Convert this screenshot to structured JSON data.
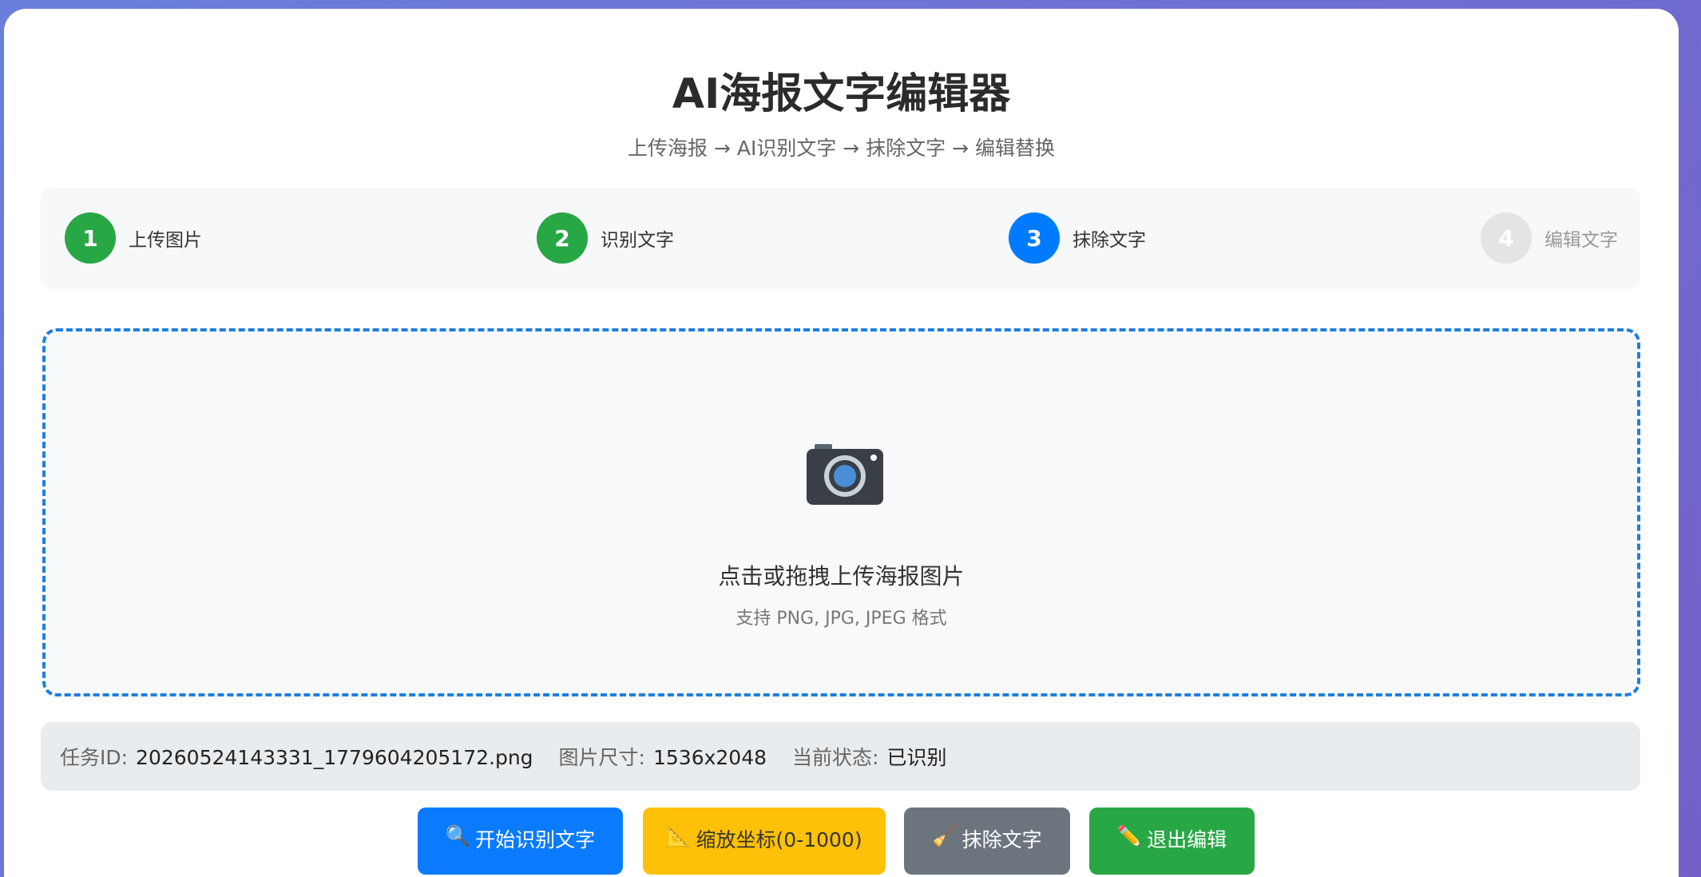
{
  "header": {
    "title": "AI海报文字编辑器",
    "subtitle": "上传海报 → AI识别文字 → 抹除文字 → 编辑替换"
  },
  "steps": [
    {
      "number": "1",
      "label": "上传图片",
      "state": "done"
    },
    {
      "number": "2",
      "label": "识别文字",
      "state": "done"
    },
    {
      "number": "3",
      "label": "抹除文字",
      "state": "active"
    },
    {
      "number": "4",
      "label": "编辑文字",
      "state": "pending"
    }
  ],
  "upload": {
    "icon": "camera-icon",
    "title": "点击或拖拽上传海报图片",
    "hint": "支持 PNG, JPG, JPEG 格式"
  },
  "info": {
    "task_id_label": "任务ID:",
    "task_id_value": "20260524143331_1779604205172.png",
    "size_label": "图片尺寸:",
    "size_value": "1536x2048",
    "status_label": "当前状态:",
    "status_value": "已识别"
  },
  "actions": {
    "recognize": {
      "icon": "🔍",
      "label": "开始识别文字"
    },
    "scale": {
      "icon": "📐",
      "label": "缩放坐标(0-1000)"
    },
    "erase": {
      "icon": "🧹",
      "label": "抹除文字"
    },
    "exit": {
      "icon": "✏️",
      "label": "退出编辑"
    }
  },
  "colors": {
    "done": "#28a745",
    "active": "#007bff",
    "pending": "#e4e4e4",
    "accent_border": "#1f7fe0",
    "background_gradient_start": "#6a7fdc",
    "background_gradient_end": "#7460c8"
  }
}
